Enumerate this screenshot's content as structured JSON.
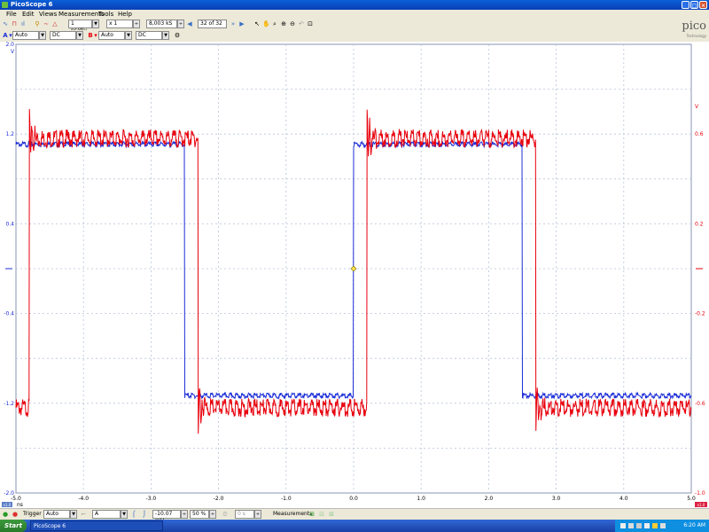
{
  "window": {
    "title": "PicoScope 6"
  },
  "menu": [
    "File",
    "Edit",
    "Views",
    "Measurements",
    "Tools",
    "Help"
  ],
  "toolbar": {
    "timebase": "1 ns/div",
    "zoom": "x 1",
    "samples": "8,003 kS",
    "buffer": "32 of 32"
  },
  "channels": {
    "a_label": "A",
    "a_range": "Auto",
    "a_coupling": "DC",
    "b_label": "B",
    "b_range": "Auto",
    "b_coupling": "DC"
  },
  "logo": {
    "text": "pico",
    "sub": "Technology"
  },
  "axes": {
    "left_ticks": [
      "2.0",
      "1.2",
      "0.4",
      "-0.4",
      "-1.2",
      "-2.0"
    ],
    "left_unit": "V",
    "right_ticks": [
      "0.6",
      "0.2",
      "-0.2",
      "-0.6",
      "-1.0"
    ],
    "right_unit": "V",
    "x_ticks": [
      "-5.0",
      "-4.0",
      "-3.0",
      "-2.0",
      "-1.0",
      "0.0",
      "1.0",
      "2.0",
      "3.0",
      "4.0",
      "5.0"
    ],
    "x_unit": "ns",
    "x_zoom": "x1.0",
    "x_end": "x1.0"
  },
  "chart_data": {
    "type": "line",
    "x_range": [
      -5.0,
      5.0
    ],
    "series": [
      {
        "channel": "A",
        "color": "#1d2ed8",
        "ylim": [
          -2.0,
          2.0
        ],
        "x": [
          -5.0,
          -2.5,
          -2.5,
          0.0,
          0.0,
          2.5,
          2.5,
          5.0
        ],
        "y": [
          1.12,
          1.12,
          -1.12,
          -1.12,
          1.12,
          1.12,
          -1.12,
          -1.12
        ]
      },
      {
        "channel": "B",
        "color": "#e8000c",
        "ylim": [
          -1.0,
          1.0
        ],
        "x": [
          -5.0,
          -4.8,
          -4.8,
          -2.3,
          -2.3,
          0.2,
          0.2,
          2.7,
          2.7,
          5.0
        ],
        "y": [
          -0.6,
          -0.6,
          0.6,
          0.6,
          -0.6,
          -0.6,
          0.6,
          0.6,
          -0.6,
          -0.6
        ]
      }
    ],
    "trigger_marker": {
      "x": 0.0,
      "y": 0.0
    }
  },
  "statusbar": {
    "trigger_label": "Trigger",
    "trigger_mode": "Auto",
    "trigger_source": "A",
    "trigger_level": "-10.07 mV",
    "pretrigger": "50 %",
    "delay": "0 s",
    "measurements_label": "Measurements"
  },
  "taskbar": {
    "start": "Start",
    "task": "PicoScope 6",
    "clock": "6:20 AM"
  },
  "colors": {
    "channel_a": "#1d2ed8",
    "channel_b": "#e8000c",
    "grid": "#b8c4d8",
    "titlebar": "#0a4fc8"
  }
}
